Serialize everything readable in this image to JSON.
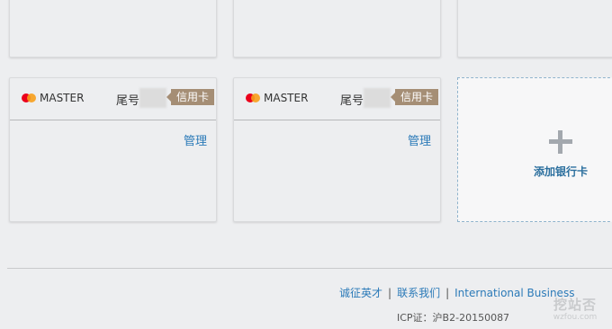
{
  "cards": [
    {
      "brand": "MASTER",
      "tail_label": "尾号",
      "type_tag": "信用卡",
      "manage_label": "管理"
    },
    {
      "brand": "MASTER",
      "tail_label": "尾号",
      "type_tag": "信用卡",
      "manage_label": "管理"
    }
  ],
  "add_card": {
    "label": "添加银行卡",
    "icon": "plus-icon"
  },
  "footer": {
    "links": [
      "诚征英才",
      "联系我们",
      "International Business"
    ],
    "separator": "|",
    "icp": "ICP证：沪B2-20150087"
  },
  "watermark": {
    "big": "挖站否",
    "small": "wzfou.com"
  },
  "colors": {
    "link": "#2b7ab8",
    "tag_bg": "#a58e75",
    "page_bg": "#edeef0"
  }
}
